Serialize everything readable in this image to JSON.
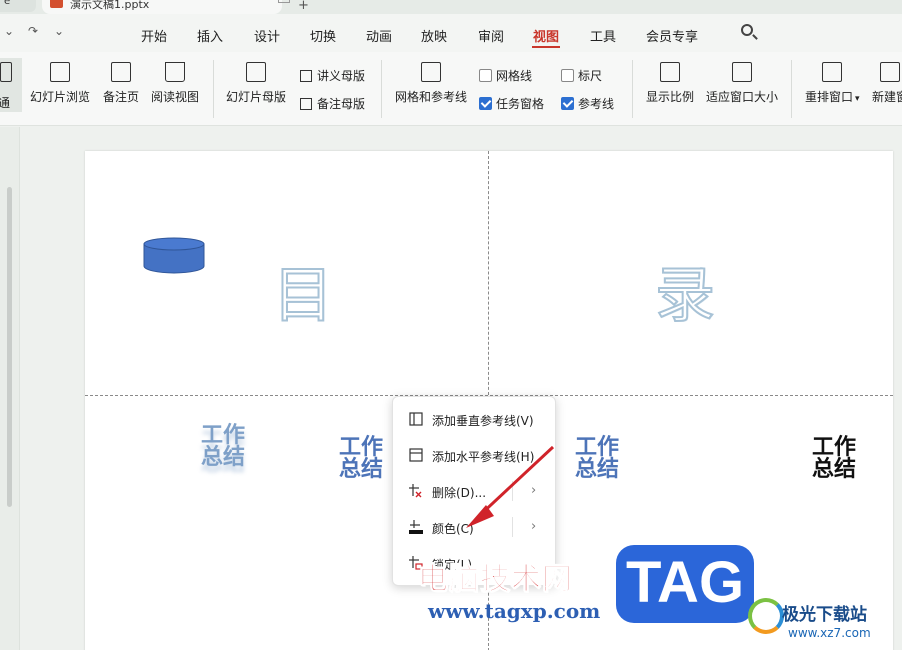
{
  "titlebar": {
    "left_tab_label": "e",
    "doc_tab_title": "演示文稿1.pptx",
    "add_tab": "+"
  },
  "quick_access": {
    "undo_dropdown": "⌄",
    "redo": "↷",
    "more": "⌄"
  },
  "menu": {
    "items": [
      "开始",
      "插入",
      "设计",
      "切换",
      "动画",
      "放映",
      "审阅",
      "视图",
      "工具",
      "会员专享"
    ],
    "active": "视图"
  },
  "ribbon": {
    "normal": "普通",
    "slide_browse": "幻灯片浏览",
    "notes_page": "备注页",
    "reading_view": "阅读视图",
    "slide_master": "幻灯片母版",
    "handout_master": "讲义母版",
    "notes_master": "备注母版",
    "grid_guides": "网格和参考线",
    "gridlines": {
      "label": "网格线",
      "checked": false
    },
    "ruler": {
      "label": "标尺",
      "checked": false
    },
    "task_pane": {
      "label": "任务窗格",
      "checked": true
    },
    "guides": {
      "label": "参考线",
      "checked": true
    },
    "show_ratio": "显示比例",
    "fit_window": "适应窗口大小",
    "rearrange_windows": "重排窗口",
    "new_window": "新建窗"
  },
  "slide": {
    "title_left": "目",
    "title_right": "录",
    "wordart": [
      {
        "line1": "工作",
        "line2": "总结",
        "style": "faded-reflection"
      },
      {
        "line1": "工作",
        "line2": "总结",
        "style": "blue-bold"
      },
      {
        "line1": "工作",
        "line2": "总结",
        "style": "blue-bold"
      },
      {
        "line1": "工作",
        "line2": "总结",
        "style": "black-outline"
      }
    ]
  },
  "context_menu": {
    "items": [
      {
        "label": "添加垂直参考线(V)",
        "icon": "vertical-guide-icon",
        "submenu": false
      },
      {
        "label": "添加水平参考线(H)",
        "icon": "horizontal-guide-icon",
        "submenu": false
      },
      {
        "label": "删除(D)...",
        "icon": "delete-guide-icon",
        "submenu": true
      },
      {
        "label": "颜色(C)",
        "icon": "color-icon",
        "submenu": true
      },
      {
        "label": "锁定(L)",
        "icon": "lock-guide-icon",
        "submenu": false
      }
    ]
  },
  "watermark": {
    "cn": "电脑技术网",
    "url": "www.tagxp.com",
    "tag": "TAG",
    "site_name": "极光下载站",
    "site_url": "www.xz7.com"
  },
  "colors": {
    "accent": "#c9372c",
    "checkbox": "#2c6fd1",
    "wordart_blue": "#4d74b8",
    "arrow": "#d0232a"
  }
}
